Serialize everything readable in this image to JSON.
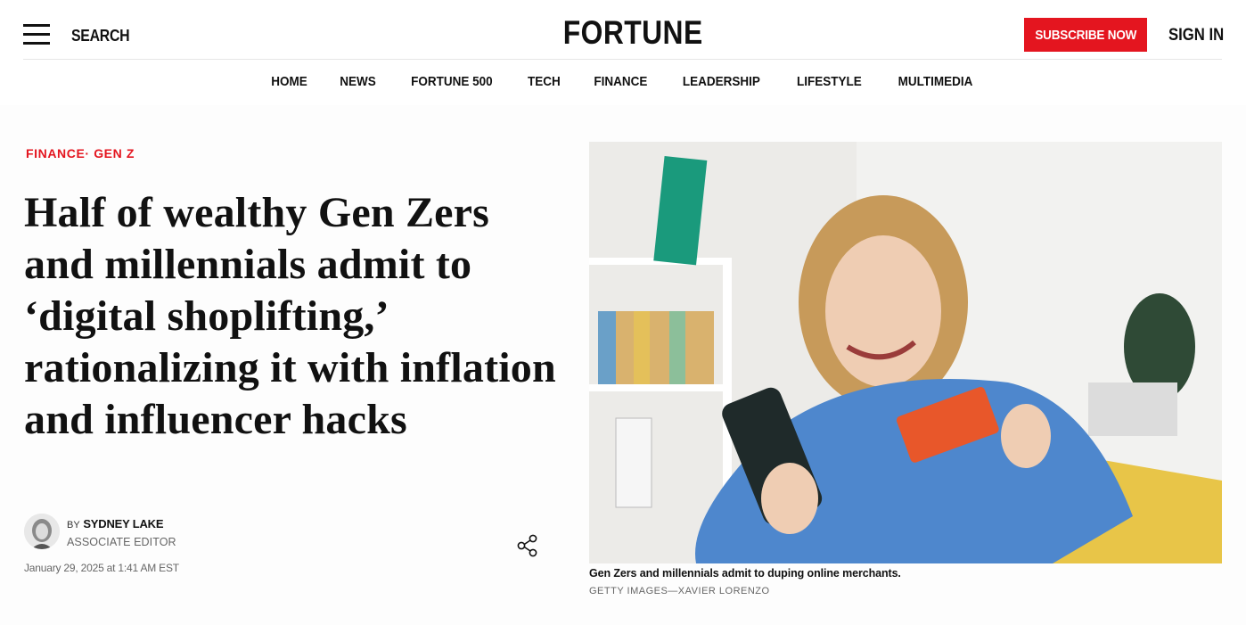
{
  "header": {
    "search_label": "SEARCH",
    "logo": "FORTUNE",
    "subscribe_label": "SUBSCRIBE NOW",
    "signin_label": "SIGN IN"
  },
  "nav": {
    "items": [
      "HOME",
      "NEWS",
      "FORTUNE 500",
      "TECH",
      "FINANCE",
      "LEADERSHIP",
      "LIFESTYLE",
      "MULTIMEDIA"
    ]
  },
  "article": {
    "section": "FINANCE",
    "section_separator": "·",
    "topic": "GEN Z",
    "headline": "Half of wealthy Gen Zers and millennials admit to ‘digital shoplifting,’ rationalizing it with inflation and influencer hacks",
    "byline_prefix": "BY",
    "author": "SYDNEY LAKE",
    "author_role": "ASSOCIATE EDITOR",
    "date": "January 29, 2025 at 1:41 AM EST",
    "image_caption": "Gen Zers and millennials admit to duping online merchants.",
    "image_credit": "GETTY IMAGES—XAVIER LORENZO"
  },
  "colors": {
    "brand_red": "#e4151f",
    "text": "#111111",
    "muted": "#666666"
  },
  "icons": {
    "menu": "hamburger-menu-icon",
    "share": "share-icon"
  }
}
